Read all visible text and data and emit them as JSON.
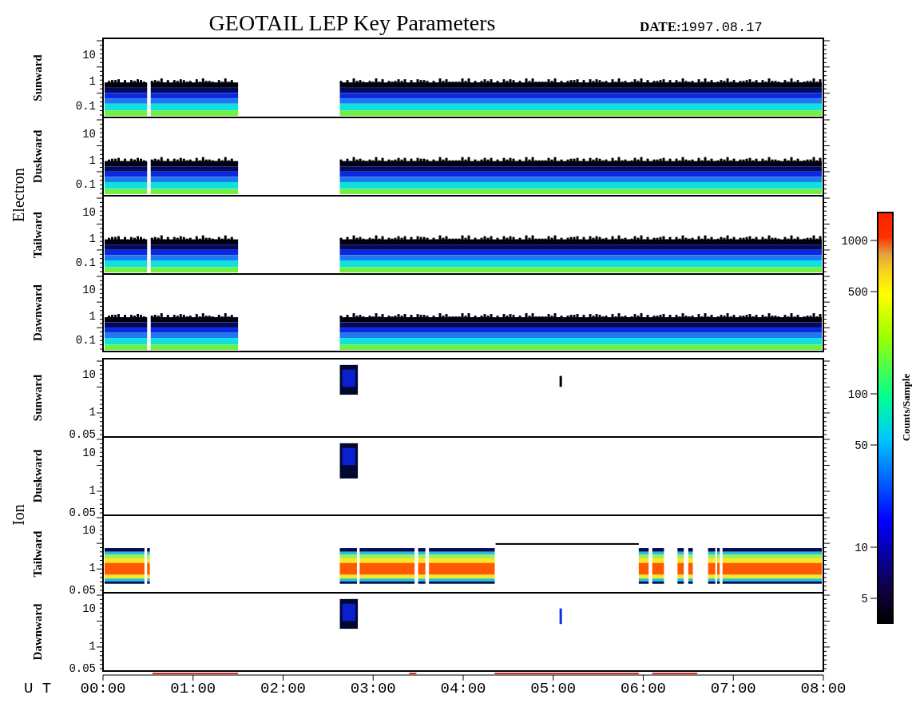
{
  "title": "GEOTAIL LEP Key Parameters",
  "date": {
    "label": "DATE:",
    "value": "1997.08.17"
  },
  "groups": [
    {
      "name": "Electron",
      "kind": "electron",
      "panels": [
        {
          "direction": "Sunward",
          "yticks": [
            "10",
            "1",
            "0.1"
          ]
        },
        {
          "direction": "Duskward",
          "yticks": [
            "10",
            "1",
            "0.1"
          ]
        },
        {
          "direction": "Tailward",
          "yticks": [
            "10",
            "1",
            "0.1"
          ]
        },
        {
          "direction": "Dawnward",
          "yticks": [
            "10",
            "1",
            "0.1"
          ]
        }
      ]
    },
    {
      "name": "Ion",
      "kind": "ion",
      "panels": [
        {
          "direction": "Sunward",
          "yticks": [
            "10",
            "1",
            "0.05"
          ]
        },
        {
          "direction": "Duskward",
          "yticks": [
            "10",
            "1",
            "0.05"
          ]
        },
        {
          "direction": "Tailward",
          "yticks": [
            "10",
            "1",
            "0.05"
          ]
        },
        {
          "direction": "Dawnward",
          "yticks": [
            "10",
            "1",
            "0.05"
          ]
        }
      ]
    }
  ],
  "time_axis": {
    "label": "U T",
    "ticks": [
      "00:00",
      "01:00",
      "02:00",
      "03:00",
      "04:00",
      "05:00",
      "06:00",
      "07:00",
      "08:00"
    ]
  },
  "colorbar": {
    "label": "Counts/Sample",
    "ticks": [
      "1000",
      "500",
      "100",
      "50",
      "10",
      "5"
    ]
  }
}
